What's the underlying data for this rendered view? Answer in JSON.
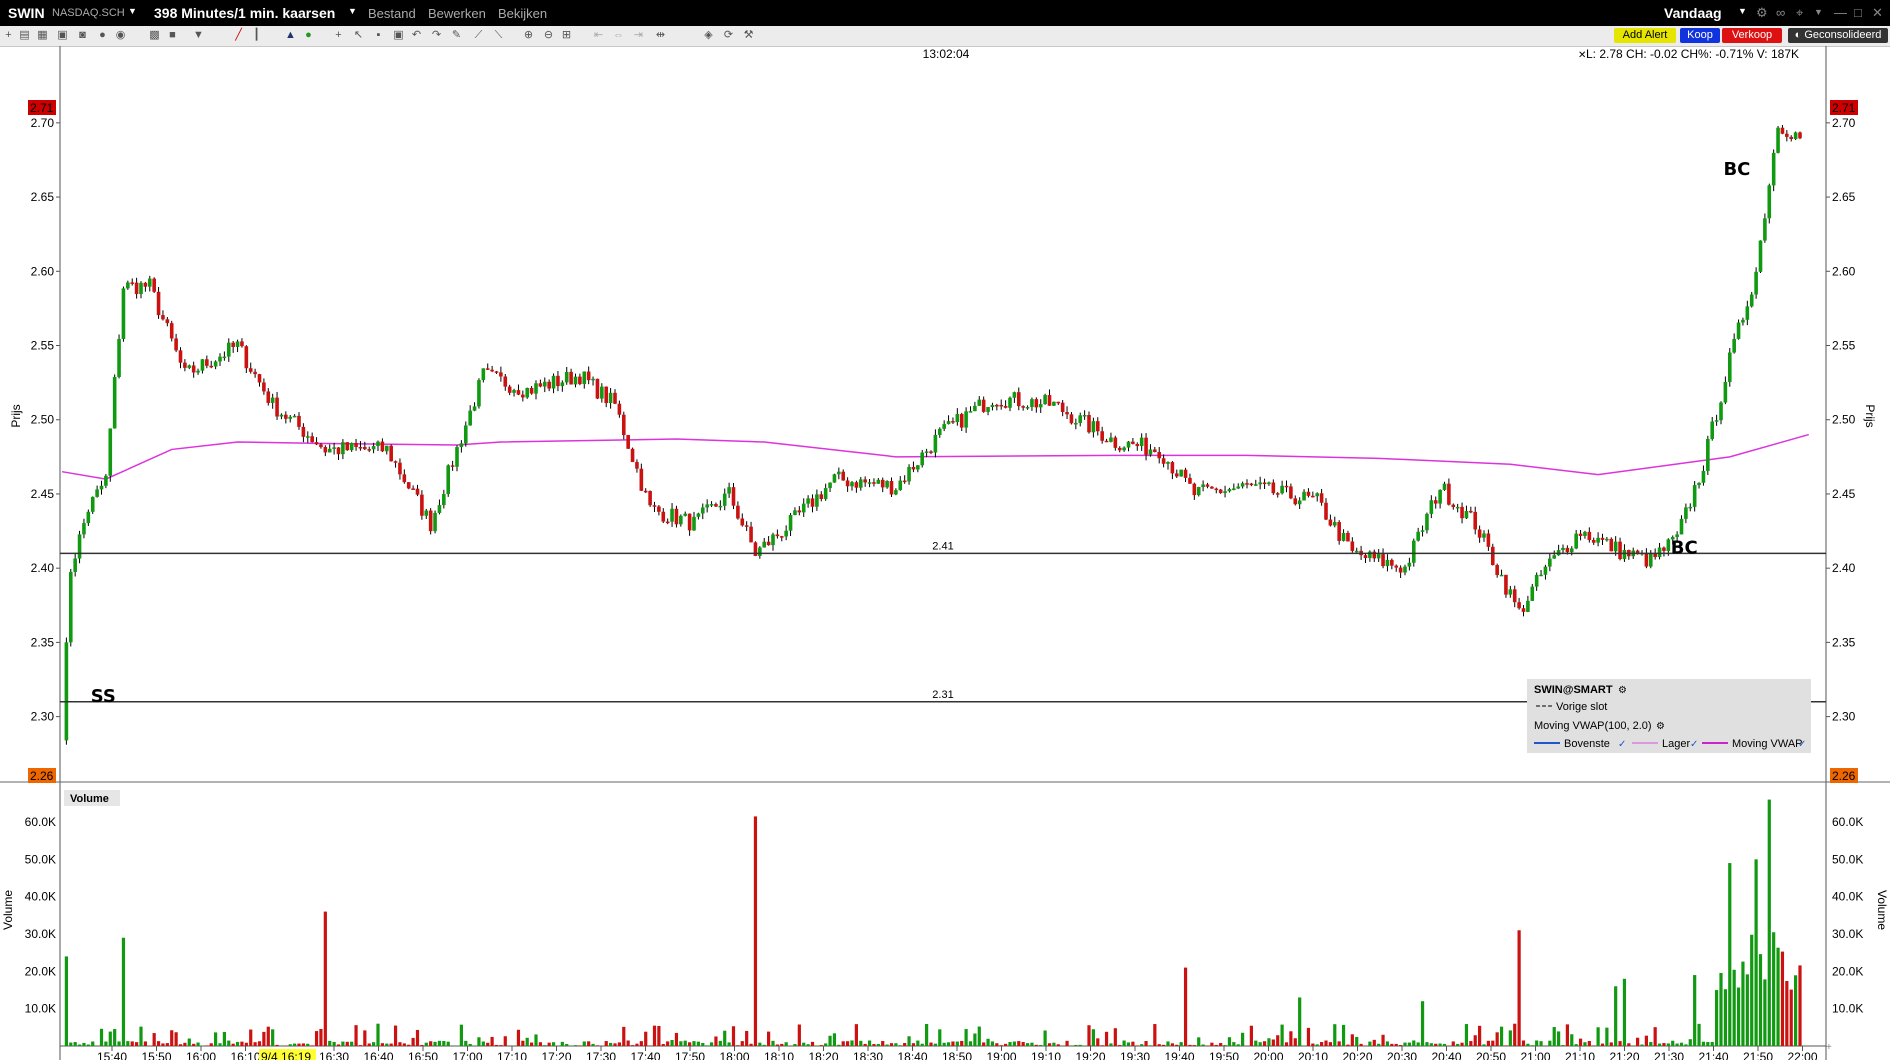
{
  "titlebar": {
    "symbol": "SWIN",
    "exchange": "NASDAQ.SCH",
    "timeframe": "398 Minutes/1 min. kaarsen",
    "menus": [
      "Bestand",
      "Bewerken",
      "Bekijken"
    ],
    "period": "Vandaag"
  },
  "toolbar": {
    "add_alert": "Add Alert",
    "buy": "Koop",
    "sell": "Verkoop",
    "consolidated": "Geconsolideerd"
  },
  "chart": {
    "crosshair_time": "13:02:04",
    "quote": "L: 2.78  CH: -0.02  CH%: -0.71%  V: 187K",
    "price_axis_label": "Prijs",
    "volume_axis_label": "Volume",
    "volume_panel_title": "Volume",
    "price_high_tag": "2.71",
    "price_low_tag": "2.26",
    "price_ticks": [
      "2.70",
      "2.65",
      "2.60",
      "2.55",
      "2.50",
      "2.45",
      "2.40",
      "2.35",
      "2.30"
    ],
    "volume_ticks": [
      "60.0K",
      "50.0K",
      "40.0K",
      "30.0K",
      "20.0K",
      "10.0K"
    ],
    "time_ticks": [
      "15:40",
      "15:50",
      "16:00",
      "16:10",
      "16:30",
      "16:40",
      "16:50",
      "17:00",
      "17:10",
      "17:20",
      "17:30",
      "17:40",
      "17:50",
      "18:00",
      "18:10",
      "18:20",
      "18:30",
      "18:40",
      "18:50",
      "19:00",
      "19:10",
      "19:20",
      "19:30",
      "19:40",
      "19:50",
      "20:00",
      "20:10",
      "20:20",
      "20:30",
      "20:40",
      "20:50",
      "21:00",
      "21:10",
      "21:20",
      "21:30",
      "21:40",
      "21:50",
      "22:00"
    ],
    "highlighted_time": "9/4 16:19",
    "hlines": [
      {
        "value": "2.41",
        "price": 2.41
      },
      {
        "value": "2.31",
        "price": 2.31
      }
    ],
    "annotations": [
      {
        "text": "SS",
        "time_index": 2,
        "price": 2.31
      },
      {
        "text": "BC",
        "time_index": 362,
        "price": 2.41
      },
      {
        "text": "BC",
        "time_index": 374,
        "price": 2.665
      }
    ],
    "colors": {
      "up": "#119911",
      "down": "#cc1111",
      "vwap": "#dd33dd",
      "high_tag": "#cc0000",
      "low_tag": "#ee6600"
    }
  },
  "legend": {
    "title": "SWIN@SMART",
    "previous_close": "Vorige slot",
    "indicator": "Moving VWAP(100, 2.0)",
    "items": [
      "Bovenste",
      "Lager",
      "Moving VWAP"
    ]
  },
  "chart_data": {
    "type": "line",
    "series": [
      {
        "name": "Moving VWAP",
        "x": [
          0,
          10,
          25,
          40,
          60,
          90,
          100,
          140,
          160,
          190,
          240,
          270,
          300,
          330,
          350,
          380,
          398
        ],
        "y": [
          2.465,
          2.46,
          2.48,
          2.485,
          2.484,
          2.483,
          2.485,
          2.487,
          2.485,
          2.475,
          2.476,
          2.476,
          2.474,
          2.47,
          2.463,
          2.475,
          2.49
        ]
      }
    ],
    "ylim": [
      2.26,
      2.71
    ],
    "volume_ylim": [
      0,
      66000
    ],
    "key_candles": [
      {
        "t": 1,
        "o": 2.29,
        "h": 2.4,
        "l": 2.29,
        "c": 2.4
      },
      {
        "t": 14,
        "o": 2.57,
        "h": 2.62,
        "l": 2.53,
        "c": 2.59
      },
      {
        "t": 158,
        "o": 2.43,
        "h": 2.43,
        "l": 2.39,
        "c": 2.41
      },
      {
        "t": 332,
        "o": 2.41,
        "h": 2.42,
        "l": 2.35,
        "c": 2.37
      },
      {
        "t": 391,
        "o": 2.62,
        "h": 2.71,
        "l": 2.61,
        "c": 2.7
      }
    ]
  }
}
